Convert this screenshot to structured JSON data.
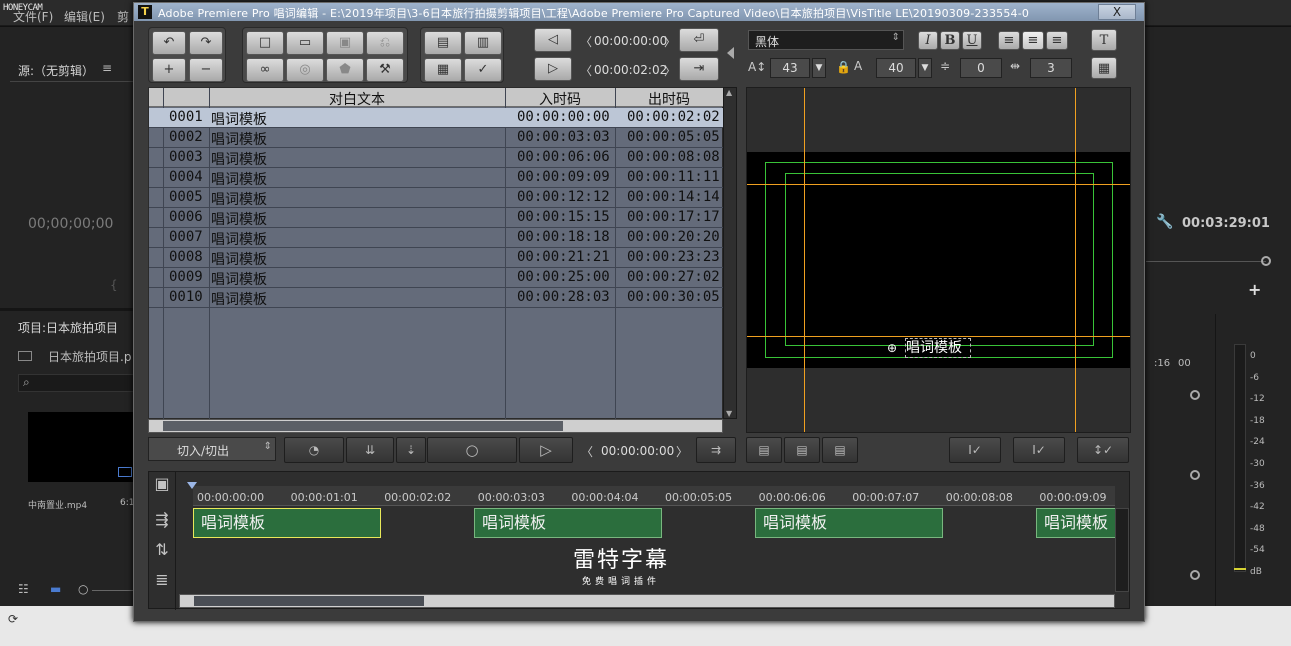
{
  "watermark": "HONEYCAM",
  "background": {
    "menu": [
      "文件(F)",
      "编辑(E)",
      "剪"
    ],
    "source_tab": "源:（无剪辑）",
    "source_menu_icon": "≡",
    "source_timecode": "00;00;00;00",
    "program_timecode": "00:03:29:01",
    "program_plus": "+",
    "program_wrench": "wrench-icon",
    "project_tab": "项目:日本旅拍项目",
    "project_file": "日本旅拍项目.p",
    "search_icon": "⌕",
    "clip_name": "中南置业.mp4",
    "clip_duration": "6:1",
    "bottom_icons": [
      "list-view-icon",
      "icon-view-icon",
      "zoom-slider"
    ],
    "mid_labels": [
      ":16",
      "00"
    ],
    "meter_labels": [
      "0",
      "-6",
      "-12",
      "-18",
      "-24",
      "-30",
      "-36",
      "-42",
      "-48",
      "-54",
      "dB"
    ]
  },
  "dialog": {
    "icon_letter": "T",
    "title": "Adobe Premiere Pro 唱词编辑 - E:\\2019年项目\\3-6日本旅行拍摄剪辑项目\\工程\\Adobe Premiere Pro Captured Video\\日本旅拍项目\\VisTitle LE\\20190309-233554-0",
    "close": "X",
    "toolbar": {
      "timecode_in": "00:00:00:00",
      "timecode_out": "00:00:02:02",
      "font_name": "黑体",
      "font_style_buttons": [
        "I",
        "B",
        "U"
      ],
      "font_size": "43",
      "tracking": "40",
      "leading": "0",
      "kerning": "3"
    },
    "grid": {
      "columns": [
        "对白文本",
        "入时码",
        "出时码"
      ],
      "rows": [
        {
          "id": "0001",
          "text": "唱词模板",
          "in": "00:00:00:00",
          "out": "00:00:02:02"
        },
        {
          "id": "0002",
          "text": "唱词模板",
          "in": "00:00:03:03",
          "out": "00:00:05:05"
        },
        {
          "id": "0003",
          "text": "唱词模板",
          "in": "00:00:06:06",
          "out": "00:00:08:08"
        },
        {
          "id": "0004",
          "text": "唱词模板",
          "in": "00:00:09:09",
          "out": "00:00:11:11"
        },
        {
          "id": "0005",
          "text": "唱词模板",
          "in": "00:00:12:12",
          "out": "00:00:14:14"
        },
        {
          "id": "0006",
          "text": "唱词模板",
          "in": "00:00:15:15",
          "out": "00:00:17:17"
        },
        {
          "id": "0007",
          "text": "唱词模板",
          "in": "00:00:18:18",
          "out": "00:00:20:20"
        },
        {
          "id": "0008",
          "text": "唱词模板",
          "in": "00:00:21:21",
          "out": "00:00:23:23"
        },
        {
          "id": "0009",
          "text": "唱词模板",
          "in": "00:00:25:00",
          "out": "00:00:27:02"
        },
        {
          "id": "0010",
          "text": "唱词模板",
          "in": "00:00:28:03",
          "out": "00:00:30:05"
        }
      ]
    },
    "preview_text": "唱词模板",
    "transport": {
      "mode": "切入/切出",
      "timecode": "00:00:00:00"
    },
    "timeline": {
      "ticks": [
        "00:00:00:00",
        "00:00:01:01",
        "00:00:02:02",
        "00:00:03:03",
        "00:00:04:04",
        "00:00:05:05",
        "00:00:06:06",
        "00:00:07:07",
        "00:00:08:08",
        "00:00:09:09"
      ],
      "clips": [
        "唱词模板",
        "唱词模板",
        "唱词模板",
        "唱词模板"
      ],
      "logo_line1": "雷特字幕",
      "logo_line2": "免费唱词插件"
    }
  }
}
